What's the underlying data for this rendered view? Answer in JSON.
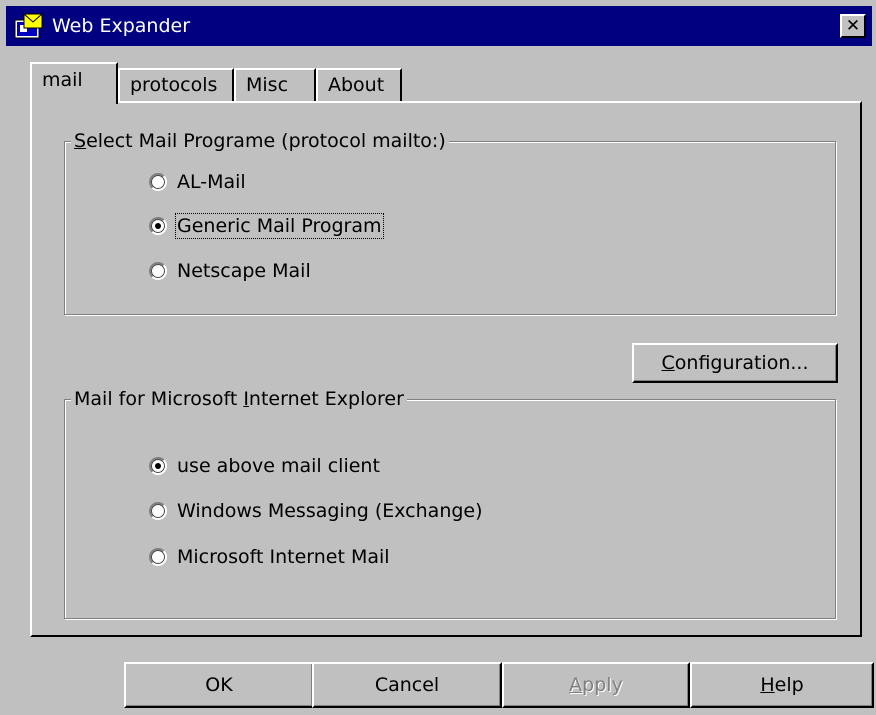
{
  "window": {
    "title": "Web Expander"
  },
  "tabs": [
    {
      "label": "mail",
      "active": true
    },
    {
      "label": "protocols",
      "active": false
    },
    {
      "label": "Misc",
      "active": false
    },
    {
      "label": "About",
      "active": false
    }
  ],
  "mail_program_group": {
    "legend_mnemonic": "S",
    "legend_rest": "elect Mail Programe (protocol mailto:)",
    "options": [
      {
        "label": "AL-Mail",
        "checked": false
      },
      {
        "label": "Generic Mail Program",
        "checked": true
      },
      {
        "label": "Netscape Mail",
        "checked": false
      }
    ]
  },
  "configuration_button": {
    "mnemonic": "C",
    "rest": "onfiguration..."
  },
  "ie_mail_group": {
    "legend_pre": "Mail for Microsoft ",
    "legend_mnemonic": "I",
    "legend_rest": "nternet Explorer",
    "options": [
      {
        "label": "use above mail client",
        "checked": true
      },
      {
        "label": "Windows Messaging (Exchange)",
        "checked": false
      },
      {
        "label": "Microsoft Internet Mail",
        "checked": false
      }
    ]
  },
  "footer": {
    "ok_label": "OK",
    "cancel_label": "Cancel",
    "apply_mnemonic": "A",
    "apply_rest": "pply",
    "help_mnemonic": "H",
    "help_rest": "elp"
  },
  "colors": {
    "titlebar": "#000080",
    "face": "#c0c0c0",
    "disabled_text": "#808080"
  },
  "icons": {
    "app": "mail-envelope-icon",
    "close": "close-icon"
  }
}
